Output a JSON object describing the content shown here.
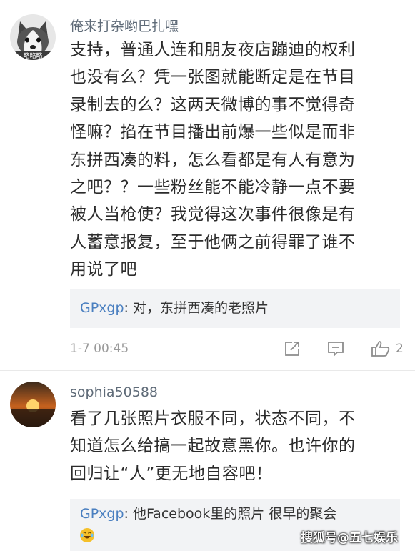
{
  "comments": [
    {
      "username": "俺来打杂哟巴扎嘿",
      "avatar_icon": "husky-dog-avatar",
      "avatar_caption": "略略略",
      "lines": [
        "支持，普通人连和朋友夜店蹦迪的权利",
        "也没有么？凭一张图就能断定是在节目",
        "录制去的么？这两天微博的事不觉得奇",
        "怪嘛？掐在节目播出前爆一些似是而非",
        "东拼西凑的料，怎么看都是有人有意为",
        "之吧？？一些粉丝能不能冷静一点不要",
        "被人当枪使？我觉得这次事件很像是有",
        "人蓄意报复，至于他俩之前得罪了谁不",
        "用说了吧"
      ],
      "reply": {
        "user": "GPxgp",
        "sep": ": ",
        "text": "对，东拼西凑的老照片"
      },
      "timestamp": "1-7 00:45",
      "like_count": "2"
    },
    {
      "username": "sophia50588",
      "avatar_icon": "sunset-avatar",
      "lines": [
        "看了几张照片衣服不同，状态不同，不",
        "知道怎么给搞一起故意黑你。也许你的",
        "回归让“人”更无地自容吧！"
      ],
      "reply": {
        "user": "GPxgp",
        "sep": ": ",
        "text": "他Facebook里的照片  很早的聚会"
      }
    }
  ],
  "watermark": "搜狐号@五七娱乐",
  "colors": {
    "reply_user": "#4a7fc0",
    "reply_bg": "#f2f3f5",
    "username": "#5f6b78"
  }
}
